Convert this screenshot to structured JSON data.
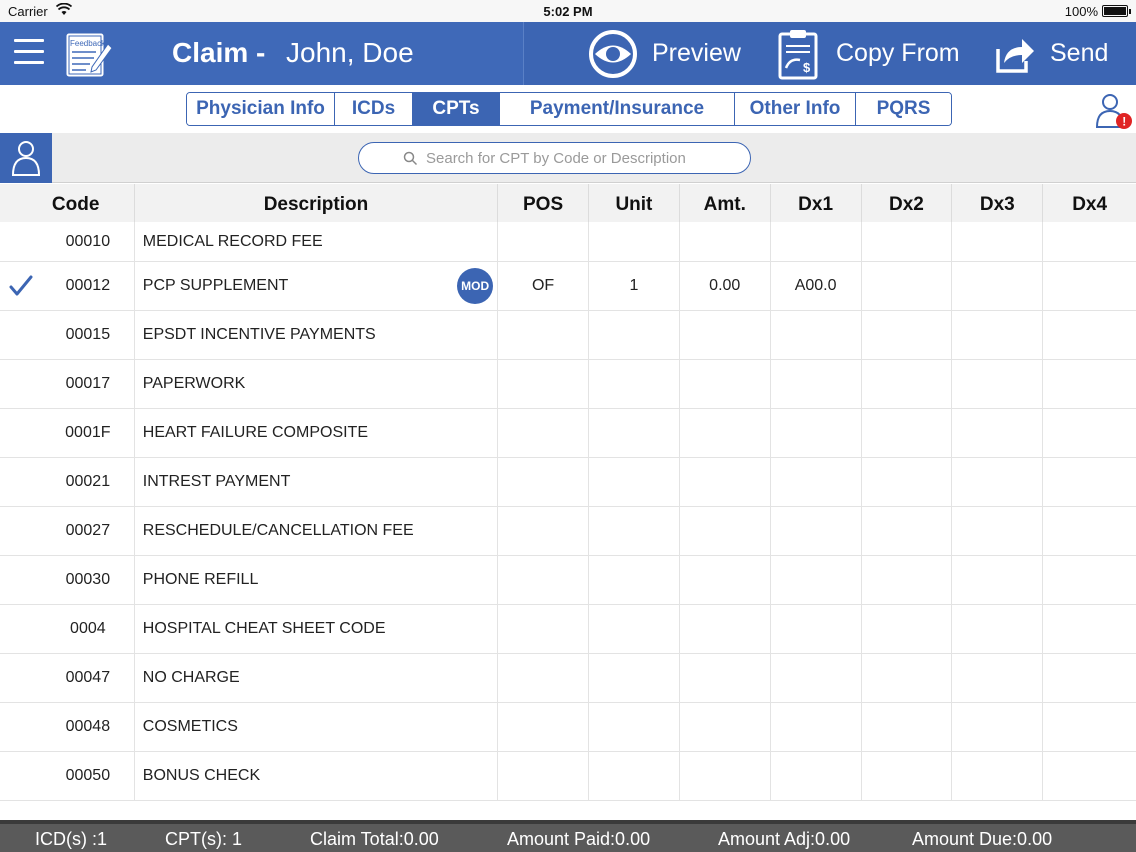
{
  "status_bar": {
    "carrier": "Carrier",
    "time": "5:02 PM",
    "battery": "100%"
  },
  "header": {
    "feedback_label": "Feedback",
    "title": "Claim -",
    "patient_name": "John, Doe",
    "preview_label": "Preview",
    "copy_from_label": "Copy From",
    "send_label": "Send"
  },
  "tabs": [
    {
      "label": "Physician Info",
      "active": false
    },
    {
      "label": "ICDs",
      "active": false
    },
    {
      "label": "CPTs",
      "active": true
    },
    {
      "label": "Payment/Insurance",
      "active": false
    },
    {
      "label": "Other Info",
      "active": false
    },
    {
      "label": "PQRS",
      "active": false
    }
  ],
  "search": {
    "placeholder": "Search for CPT by Code or Description"
  },
  "table": {
    "headers": {
      "code": "Code",
      "description": "Description",
      "pos": "POS",
      "unit": "Unit",
      "amt": "Amt.",
      "dx1": "Dx1",
      "dx2": "Dx2",
      "dx3": "Dx3",
      "dx4": "Dx4"
    },
    "rows": [
      {
        "selected": false,
        "code": "00010",
        "description": "MEDICAL RECORD FEE",
        "mod": "",
        "pos": "",
        "unit": "",
        "amt": "",
        "dx1": "",
        "dx2": "",
        "dx3": "",
        "dx4": ""
      },
      {
        "selected": true,
        "code": "00012",
        "description": "PCP SUPPLEMENT",
        "mod": "MOD",
        "pos": "OF",
        "unit": "1",
        "amt": "0.00",
        "dx1": "A00.0",
        "dx2": "",
        "dx3": "",
        "dx4": ""
      },
      {
        "selected": false,
        "code": "00015",
        "description": "EPSDT INCENTIVE PAYMENTS",
        "mod": "",
        "pos": "",
        "unit": "",
        "amt": "",
        "dx1": "",
        "dx2": "",
        "dx3": "",
        "dx4": ""
      },
      {
        "selected": false,
        "code": "00017",
        "description": "PAPERWORK",
        "mod": "",
        "pos": "",
        "unit": "",
        "amt": "",
        "dx1": "",
        "dx2": "",
        "dx3": "",
        "dx4": ""
      },
      {
        "selected": false,
        "code": "0001F",
        "description": "HEART FAILURE COMPOSITE",
        "mod": "",
        "pos": "",
        "unit": "",
        "amt": "",
        "dx1": "",
        "dx2": "",
        "dx3": "",
        "dx4": ""
      },
      {
        "selected": false,
        "code": "00021",
        "description": "INTREST PAYMENT",
        "mod": "",
        "pos": "",
        "unit": "",
        "amt": "",
        "dx1": "",
        "dx2": "",
        "dx3": "",
        "dx4": ""
      },
      {
        "selected": false,
        "code": "00027",
        "description": "RESCHEDULE/CANCELLATION FEE",
        "mod": "",
        "pos": "",
        "unit": "",
        "amt": "",
        "dx1": "",
        "dx2": "",
        "dx3": "",
        "dx4": ""
      },
      {
        "selected": false,
        "code": "00030",
        "description": "PHONE REFILL",
        "mod": "",
        "pos": "",
        "unit": "",
        "amt": "",
        "dx1": "",
        "dx2": "",
        "dx3": "",
        "dx4": ""
      },
      {
        "selected": false,
        "code": "0004",
        "description": "HOSPITAL CHEAT SHEET CODE",
        "mod": "",
        "pos": "",
        "unit": "",
        "amt": "",
        "dx1": "",
        "dx2": "",
        "dx3": "",
        "dx4": ""
      },
      {
        "selected": false,
        "code": "00047",
        "description": "NO CHARGE",
        "mod": "",
        "pos": "",
        "unit": "",
        "amt": "",
        "dx1": "",
        "dx2": "",
        "dx3": "",
        "dx4": ""
      },
      {
        "selected": false,
        "code": "00048",
        "description": "COSMETICS",
        "mod": "",
        "pos": "",
        "unit": "",
        "amt": "",
        "dx1": "",
        "dx2": "",
        "dx3": "",
        "dx4": ""
      },
      {
        "selected": false,
        "code": "00050",
        "description": "BONUS CHECK",
        "mod": "",
        "pos": "",
        "unit": "",
        "amt": "",
        "dx1": "",
        "dx2": "",
        "dx3": "",
        "dx4": ""
      }
    ]
  },
  "footer": {
    "icds": "ICD(s) :1",
    "cpts": "CPT(s): 1",
    "claim_total": "Claim Total:0.00",
    "amount_paid": "Amount Paid:0.00",
    "amount_adj": "Amount Adj:0.00",
    "amount_due": "Amount Due:0.00"
  },
  "colors": {
    "brand_blue": "#3c65b3",
    "alert_red": "#e02424"
  },
  "icons": [
    "wifi-icon",
    "battery-icon",
    "menu-icon",
    "feedback-icon",
    "preview-eye-icon",
    "copy-from-clipboard-icon",
    "send-share-icon",
    "user-alert-icon",
    "user-icon",
    "search-icon",
    "checkmark-icon"
  ]
}
